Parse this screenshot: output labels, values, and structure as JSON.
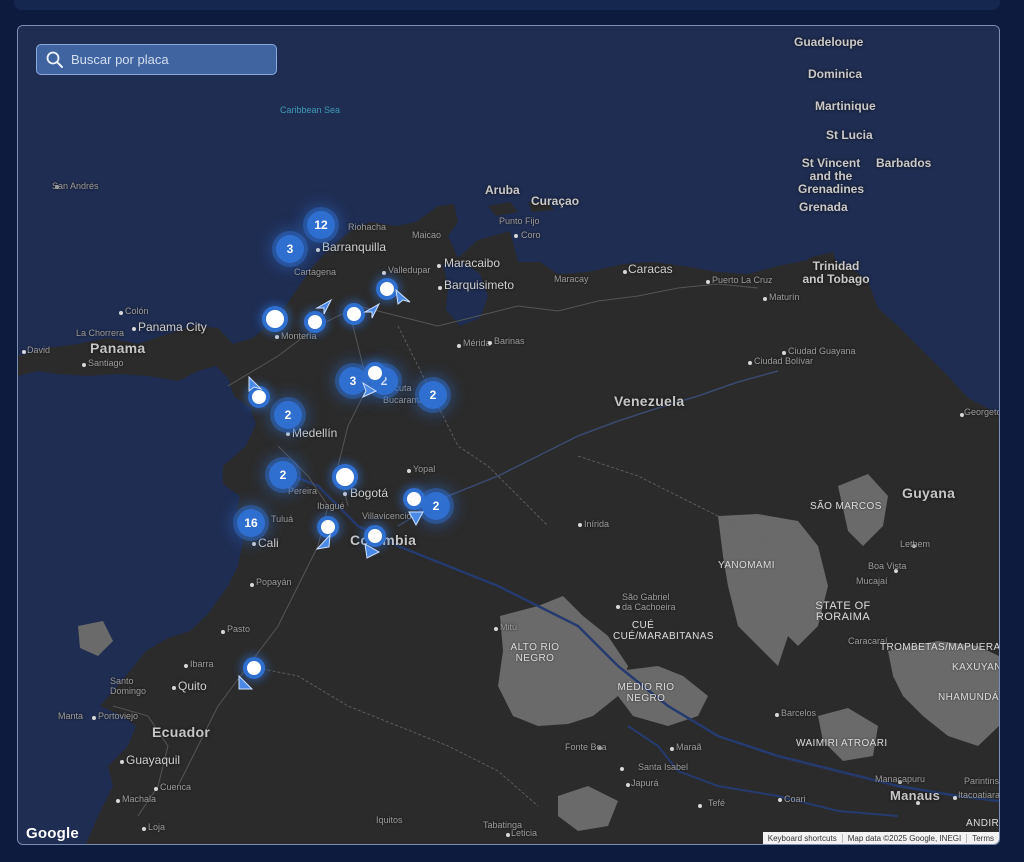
{
  "search": {
    "placeholder": "Buscar por placa",
    "icon": "search-icon"
  },
  "map": {
    "attribution": {
      "logo": "Google",
      "shortcuts": "Keyboard shortcuts",
      "data": "Map data ©2025 Google, INEGI",
      "terms": "Terms"
    },
    "sea_labels": [
      "Caribbean Sea"
    ],
    "country_labels": [
      "Panama",
      "Venezuela",
      "Colombia",
      "Ecuador",
      "Guyana"
    ],
    "island_labels": [
      "Guadeloupe",
      "Dominica",
      "Martinique",
      "St Lucia",
      "St Vincent and the Grenadines",
      "Barbados",
      "Grenada",
      "Trinidad and Tobago",
      "Aruba",
      "Curaçao"
    ],
    "city_labels": [
      "San Andrés",
      "Barranquilla",
      "Cartagena",
      "Riohacha",
      "Maicao",
      "Punto Fijo",
      "Coro",
      "Maracaibo",
      "Valledupar",
      "Barquisimeto",
      "Caracas",
      "Maracay",
      "Puerto La Cruz",
      "Maturín",
      "Panama City",
      "Colón",
      "La Chorrera",
      "David",
      "Santiago",
      "Montería",
      "Mérida",
      "Barinas",
      "Ciudad Guayana",
      "Ciudad Bolívar",
      "Cúcuta",
      "Bucaramanga",
      "Medellín",
      "Yopal",
      "Bogotá",
      "Pereira",
      "Ibagué",
      "Villavicencio",
      "Tuluá",
      "Cali",
      "Popayán",
      "Pasto",
      "Ibarra",
      "Quito",
      "Santo Domingo",
      "Portoviejo",
      "Manta",
      "Guayaquil",
      "Machala",
      "Cuenca",
      "Loja",
      "Iquitos",
      "Leticia",
      "Tabatinga",
      "Manaus",
      "Boa Vista",
      "Georgetown",
      "Lethem",
      "Mucajaí",
      "Caracaraí",
      "Barcelos",
      "Tefé",
      "Coari",
      "Itacoatiara",
      "Manacapuru",
      "Santa Isabel",
      "Mitú",
      "Inírida",
      "São Gabriel da Cachoeira",
      "Japurá",
      "Maraã",
      "Fonte Boa",
      "Parintins"
    ],
    "region_labels": [
      "YANOMAMI",
      "SÃO MARCOS",
      "STATE OF RORAIMA",
      "TROMBETAS/MAPUERA",
      "KAXUYANA",
      "NHAMUNDÁ/MAPUERA",
      "WAIMIRI ATROARI",
      "ALTO RIO NEGRO",
      "CUÉ CUÉ/MARABITANAS",
      "MÉDIO RIO NEGRO",
      "ANDIRÁ"
    ],
    "clusters": [
      {
        "count": "12"
      },
      {
        "count": "3"
      },
      {
        "count": "3"
      },
      {
        "count": "2"
      },
      {
        "count": "2"
      },
      {
        "count": "2"
      },
      {
        "count": "2"
      },
      {
        "count": "2"
      },
      {
        "count": "16"
      }
    ]
  },
  "colors": {
    "accent": "#2f6fd0",
    "land": "#2b2b2b",
    "water": "#1f2d52",
    "background": "#0d1b3e",
    "indigenous": "#6a6a6a"
  }
}
